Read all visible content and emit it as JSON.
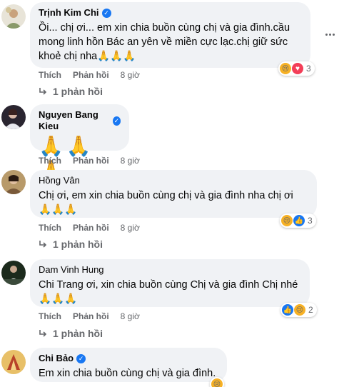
{
  "colors": {
    "bubble": "#f0f2f5",
    "verified": "#1877f2",
    "meta": "#65676b"
  },
  "comments": [
    {
      "author": "Trịnh Kim Chi",
      "verified": true,
      "text": "Ồi... chị ơi... em xin chia buồn cùng chị và gia đình.cầu mong linh hồn Bác an yên về miền cực lạc.chị giữ sức khoẻ chị nha🙏🙏🙏",
      "like": "Thích",
      "reply": "Phản hồi",
      "time": "8 giờ",
      "reaction_count": "3",
      "reactions": [
        "sad-reaction-icon",
        "love-reaction-icon"
      ],
      "replies": "1 phản hồi"
    },
    {
      "author": "Nguyen Bang Kieu",
      "verified": true,
      "text": "🙏🙏🙏",
      "like": "Thích",
      "reply": "Phản hồi",
      "time": "8 giờ"
    },
    {
      "author": "Hồng Vân",
      "verified": false,
      "text": "Chị ơi, em xin chia buồn cùng chị và gia đình nha chị ơi\n🙏🙏🙏",
      "like": "Thích",
      "reply": "Phản hồi",
      "time": "8 giờ",
      "reaction_count": "3",
      "reactions": [
        "sad-reaction-icon",
        "like-reaction-icon"
      ],
      "replies": "1 phản hồi"
    },
    {
      "author": "Dam Vinh Hung",
      "verified": false,
      "text": "Chi Trang ơi, xin chia buồn cùng Chị và gia đình Chị nhé\n🙏🙏🙏",
      "like": "Thích",
      "reply": "Phản hồi",
      "time": "8 giờ",
      "reaction_count": "2",
      "reactions": [
        "like-reaction-icon",
        "sad-reaction-icon"
      ],
      "replies": "1 phản hồi"
    },
    {
      "author": "Chi Bảo",
      "verified": true,
      "text": "Em xin chia buồn cùng chị và gia đình.",
      "reactions": [
        "sad-reaction-icon"
      ]
    }
  ]
}
